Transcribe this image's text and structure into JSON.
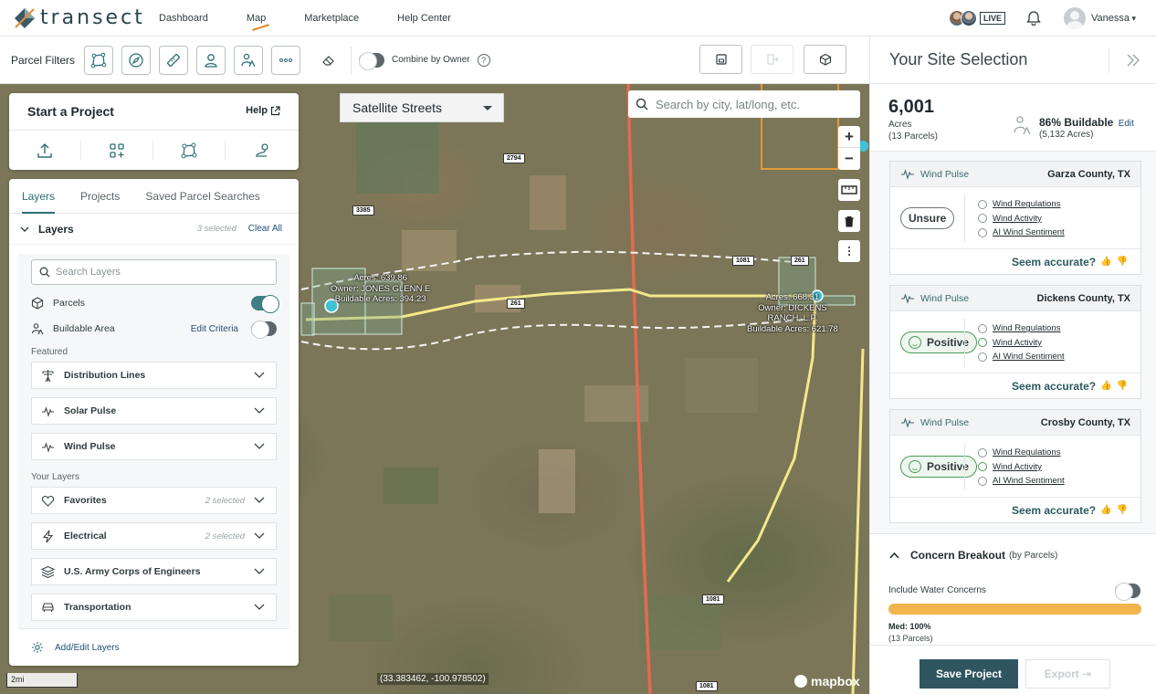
{
  "nav": {
    "brand": "transect",
    "links": [
      "Dashboard",
      "Map",
      "Marketplace",
      "Help Center"
    ],
    "active": "Map",
    "live_label": "LIVE",
    "username": "Vanessa"
  },
  "toolbar": {
    "label": "Parcel Filters",
    "combine_label": "Combine by Owner",
    "help_glyph": "?",
    "combine_on": false
  },
  "map": {
    "style_select": "Satellite Streets",
    "search_placeholder": "Search by city, lat/long, etc.",
    "zoom_in": "+",
    "zoom_out": "−",
    "roads": [
      "2794",
      "3385",
      "261",
      "1081",
      "261",
      "261",
      "1081",
      "1081"
    ],
    "parcel_west": [
      "Acres: 639.86",
      "Owner: JONES GLENN E",
      "Buildable Acres: 394.23"
    ],
    "parcel_east": [
      "Acres: 668.31",
      "Owner: DICKENS",
      "RANCH, L.P.",
      "Buildable Acres: 621.78"
    ],
    "scale": "2mi",
    "coords": "(33.383462, -100.978502)",
    "attribution": "mapbox"
  },
  "start_project": {
    "title": "Start a Project",
    "help": "Help"
  },
  "layers": {
    "tabs": [
      "Layers",
      "Projects",
      "Saved Parcel Searches"
    ],
    "header": "Layers",
    "selected": "3 selected",
    "clear": "Clear All",
    "search_placeholder": "Search Layers",
    "parcels": "Parcels",
    "buildable": "Buildable Area",
    "edit_criteria": "Edit Criteria",
    "featured_label": "Featured",
    "featured": [
      "Distribution Lines",
      "Solar Pulse",
      "Wind Pulse"
    ],
    "your_layers_label": "Your Layers",
    "your_layers": [
      {
        "name": "Favorites",
        "count": "2 selected"
      },
      {
        "name": "Electrical",
        "count": "2 selected"
      },
      {
        "name": "U.S. Army Corps of Engineers",
        "count": ""
      },
      {
        "name": "Transportation",
        "count": ""
      }
    ],
    "footer": "Add/Edit Layers"
  },
  "site": {
    "title": "Your Site Selection",
    "acres": "6,001",
    "acres_label": "Acres",
    "parcels": "(13 Parcels)",
    "buildable_pct": "86% Buildable",
    "edit": "Edit",
    "buildable_acres": "(5,132 Acres)",
    "cards": [
      {
        "pulse": "Wind Pulse",
        "county": "Garza County, TX",
        "status": "Unsure",
        "positive": false,
        "items": [
          "Wind Regulations",
          "Wind Activity",
          "AI Wind Sentiment"
        ],
        "accurate": "Seem accurate?"
      },
      {
        "pulse": "Wind Pulse",
        "county": "Dickens County, TX",
        "status": "Positive",
        "positive": true,
        "items": [
          "Wind Regulations",
          "Wind Activity",
          "AI Wind Sentiment"
        ],
        "accurate": "Seem accurate?"
      },
      {
        "pulse": "Wind Pulse",
        "county": "Crosby County, TX",
        "status": "Positive",
        "positive": true,
        "items": [
          "Wind Regulations",
          "Wind Activity",
          "AI Wind Sentiment"
        ],
        "accurate": "Seem accurate?"
      }
    ],
    "concern_title": "Concern Breakout",
    "concern_sub": "(by Parcels)",
    "water_label": "Include Water Concerns",
    "med_label": "Med: 100%",
    "med_sub": "(13 Parcels)",
    "med_fraction": 1.0,
    "save": "Save Project",
    "export": "Export"
  },
  "colors": {
    "accent": "#2b6f75",
    "nav_underline": "#e58a2b",
    "save_button": "#2f5560",
    "concern_bar": "#f2b54d",
    "power_line": "#e46a4f",
    "road_highlight": "#f3e88a"
  }
}
